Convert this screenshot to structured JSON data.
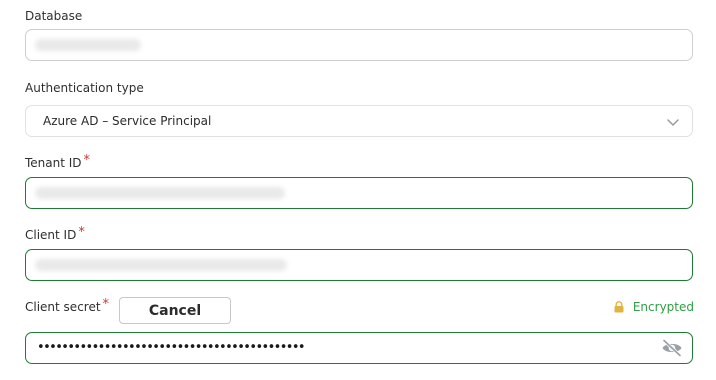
{
  "database": {
    "label": "Database"
  },
  "auth_type": {
    "label": "Authentication type",
    "value": "Azure AD – Service Principal",
    "chevron_icon": "chevron-down-icon"
  },
  "tenant_id": {
    "label": "Tenant ID",
    "required_mark": "*"
  },
  "client_id": {
    "label": "Client ID",
    "required_mark": "*"
  },
  "client_secret": {
    "label": "Client secret",
    "required_mark": "*",
    "cancel_label": "Cancel",
    "encrypted_label": "Encrypted",
    "lock_icon": "lock-icon",
    "masked_value": "••••••••••••••••••••••••••••••••••••••••••••",
    "visibility_icon": "eye-off-icon"
  },
  "colors": {
    "valid_border": "#1e7b34",
    "required": "#d13438",
    "encrypted_text": "#2f9e44",
    "lock": "#e3b341"
  }
}
